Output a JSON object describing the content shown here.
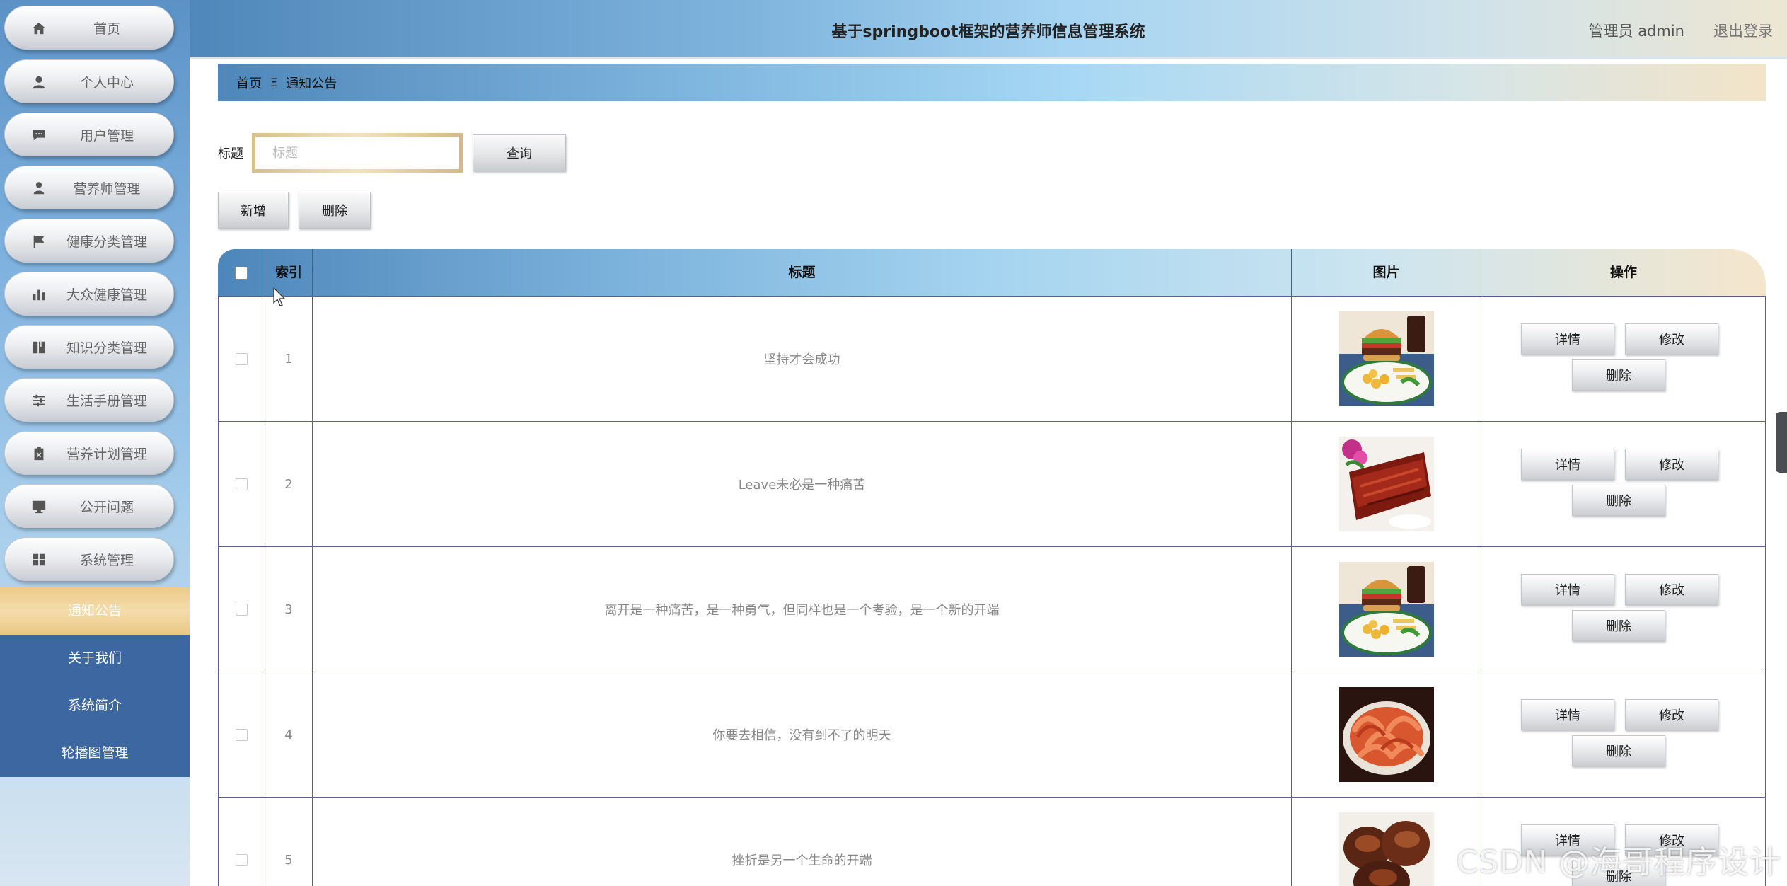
{
  "app": {
    "title": "基于springboot框架的营养师信息管理系统",
    "user_label": "管理员 admin",
    "logout_label": "退出登录"
  },
  "sidebar": {
    "items": [
      {
        "label": "首页",
        "icon": "home-icon"
      },
      {
        "label": "个人中心",
        "icon": "user-icon"
      },
      {
        "label": "用户管理",
        "icon": "chat-icon"
      },
      {
        "label": "营养师管理",
        "icon": "person-icon"
      },
      {
        "label": "健康分类管理",
        "icon": "flag-icon"
      },
      {
        "label": "大众健康管理",
        "icon": "bar-chart-icon"
      },
      {
        "label": "知识分类管理",
        "icon": "book-icon"
      },
      {
        "label": "生活手册管理",
        "icon": "sliders-icon"
      },
      {
        "label": "营养计划管理",
        "icon": "clipboard-icon"
      },
      {
        "label": "公开问题",
        "icon": "monitor-icon"
      },
      {
        "label": "系统管理",
        "icon": "grid-icon"
      }
    ],
    "submenu": [
      {
        "label": "通知公告",
        "active": true
      },
      {
        "label": "关于我们",
        "active": false
      },
      {
        "label": "系统简介",
        "active": false
      },
      {
        "label": "轮播图管理",
        "active": false
      }
    ]
  },
  "breadcrumb": {
    "home": "首页",
    "separator": "Ξ",
    "current": "通知公告"
  },
  "search": {
    "label": "标题",
    "placeholder": "标题",
    "value": "",
    "query_button": "查询"
  },
  "actions": {
    "add_label": "新增",
    "delete_label": "删除"
  },
  "table": {
    "columns": {
      "index": "索引",
      "title": "标题",
      "image": "图片",
      "operations": "操作"
    },
    "rows": [
      {
        "index": "1",
        "title": "坚持才会成功",
        "image": "burger-plate"
      },
      {
        "index": "2",
        "title": "Leave未必是一种痛苦",
        "image": "roast-meat"
      },
      {
        "index": "3",
        "title": "离开是一种痛苦，是一种勇气，但同样也是一个考验，是一个新的开端",
        "image": "burger-plate"
      },
      {
        "index": "4",
        "title": "你要去相信，没有到不了的明天",
        "image": "shrimp-bowl"
      },
      {
        "index": "5",
        "title": "挫折是另一个生命的开端",
        "image": "roast-chicken"
      }
    ],
    "row_buttons": {
      "detail": "详情",
      "edit": "修改",
      "delete": "删除"
    }
  },
  "watermark": "CSDN @海哥程序设计",
  "colors": {
    "sidebar_submenu": "#3c67a0",
    "active_submenu": "#eccb8a",
    "header_start": "#4f87ba",
    "header_end": "#eee6d2"
  }
}
